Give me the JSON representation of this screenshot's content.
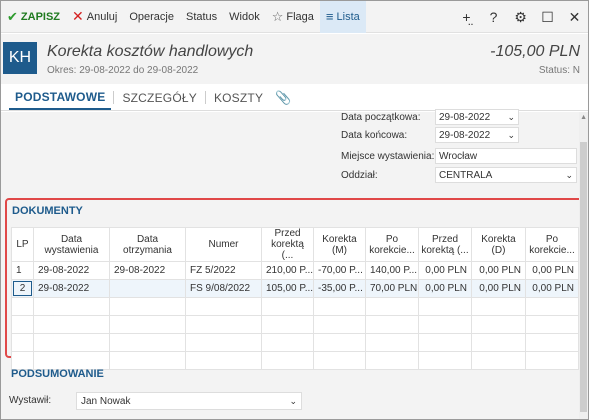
{
  "toolbar": {
    "save_label": "ZAPISZ",
    "cancel_label": "Anuluj",
    "operations_label": "Operacje",
    "status_label": "Status",
    "view_label": "Widok",
    "flag_label": "Flaga",
    "list_label": "Lista"
  },
  "header": {
    "badge": "KH",
    "title": "Korekta kosztów handlowych",
    "period": "Okres: 29-08-2022 do 29-08-2022",
    "amount": "-105,00 PLN",
    "status": "Status: N"
  },
  "tabs": [
    {
      "label": "PODSTAWOWE",
      "active": true
    },
    {
      "label": "SZCZEGÓŁY",
      "active": false
    },
    {
      "label": "KOSZTY",
      "active": false
    }
  ],
  "form": {
    "start_date_label": "Data początkowa:",
    "start_date_value": "29-08-2022",
    "end_date_label": "Data końcowa:",
    "end_date_value": "29-08-2022",
    "place_label": "Miejsce wystawienia:",
    "place_value": "Wrocław",
    "branch_label": "Oddział:",
    "branch_value": "CENTRALA"
  },
  "documents": {
    "title": "DOKUMENTY",
    "columns": [
      "LP",
      "Data wystawienia",
      "Data otrzymania",
      "Numer",
      "Przed korektą (...",
      "Korekta (M)",
      "Po korekcie...",
      "Przed korektą (...",
      "Korekta (D)",
      "Po korekcie..."
    ],
    "rows": [
      [
        "1",
        "29-08-2022",
        "29-08-2022",
        "FZ 5/2022",
        "210,00 P...",
        "-70,00 P...",
        "140,00 P...",
        "0,00 PLN",
        "0,00 PLN",
        "0,00 PLN"
      ],
      [
        "2",
        "29-08-2022",
        "",
        "FS 9/08/2022",
        "105,00 P...",
        "-35,00 P...",
        "70,00 PLN",
        "0,00 PLN",
        "0,00 PLN",
        "0,00 PLN"
      ]
    ]
  },
  "summary": {
    "title": "PODSUMOWANIE",
    "issued_by_label": "Wystawił:",
    "issued_by_value": "Jan Nowak"
  }
}
